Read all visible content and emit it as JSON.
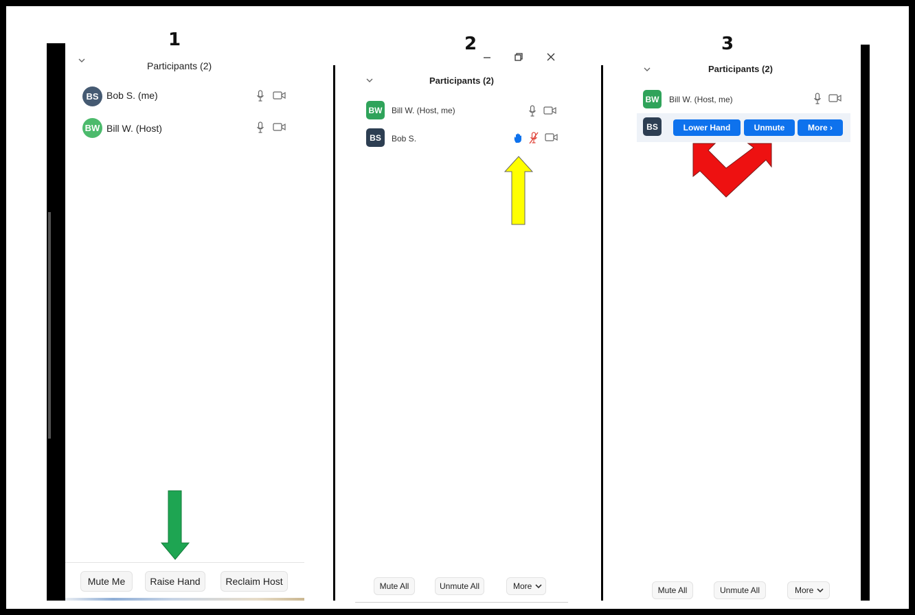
{
  "steps": [
    "1",
    "2",
    "3"
  ],
  "panel1": {
    "title": "Participants (2)",
    "participants": [
      {
        "initials": "BS",
        "name": "Bob S. (me)",
        "color": "#455a72"
      },
      {
        "initials": "BW",
        "name": "Bill W. (Host)",
        "color": "#4cba6c"
      }
    ],
    "buttons": [
      "Mute Me",
      "Raise Hand",
      "Reclaim Host"
    ]
  },
  "panel2": {
    "title": "Participants (2)",
    "window_controls": [
      "minimize-icon",
      "restore-icon",
      "close-icon"
    ],
    "participants": [
      {
        "initials": "BW",
        "name": "Bill W. (Host, me)",
        "color": "#2fa35a"
      },
      {
        "initials": "BS",
        "name": "Bob S.",
        "color": "#2d3e52",
        "hand_raised": true,
        "muted": true
      }
    ],
    "buttons": [
      "Mute All",
      "Unmute All",
      "More"
    ]
  },
  "panel3": {
    "title": "Participants (2)",
    "participants": [
      {
        "initials": "BW",
        "name": "Bill W. (Host, me)",
        "color": "#2fa35a"
      },
      {
        "initials": "BS",
        "name": "",
        "color": "#2d3e52"
      }
    ],
    "row_actions": [
      "Lower Hand",
      "Unmute",
      "More ›"
    ],
    "buttons": [
      "Mute All",
      "Unmute All",
      "More"
    ]
  },
  "colors": {
    "accent_blue": "#0e72ed",
    "arrow_green": "#1ea552",
    "arrow_yellow": "#ffff00",
    "arrow_red": "#ee1111",
    "muted_red": "#e0463c"
  }
}
